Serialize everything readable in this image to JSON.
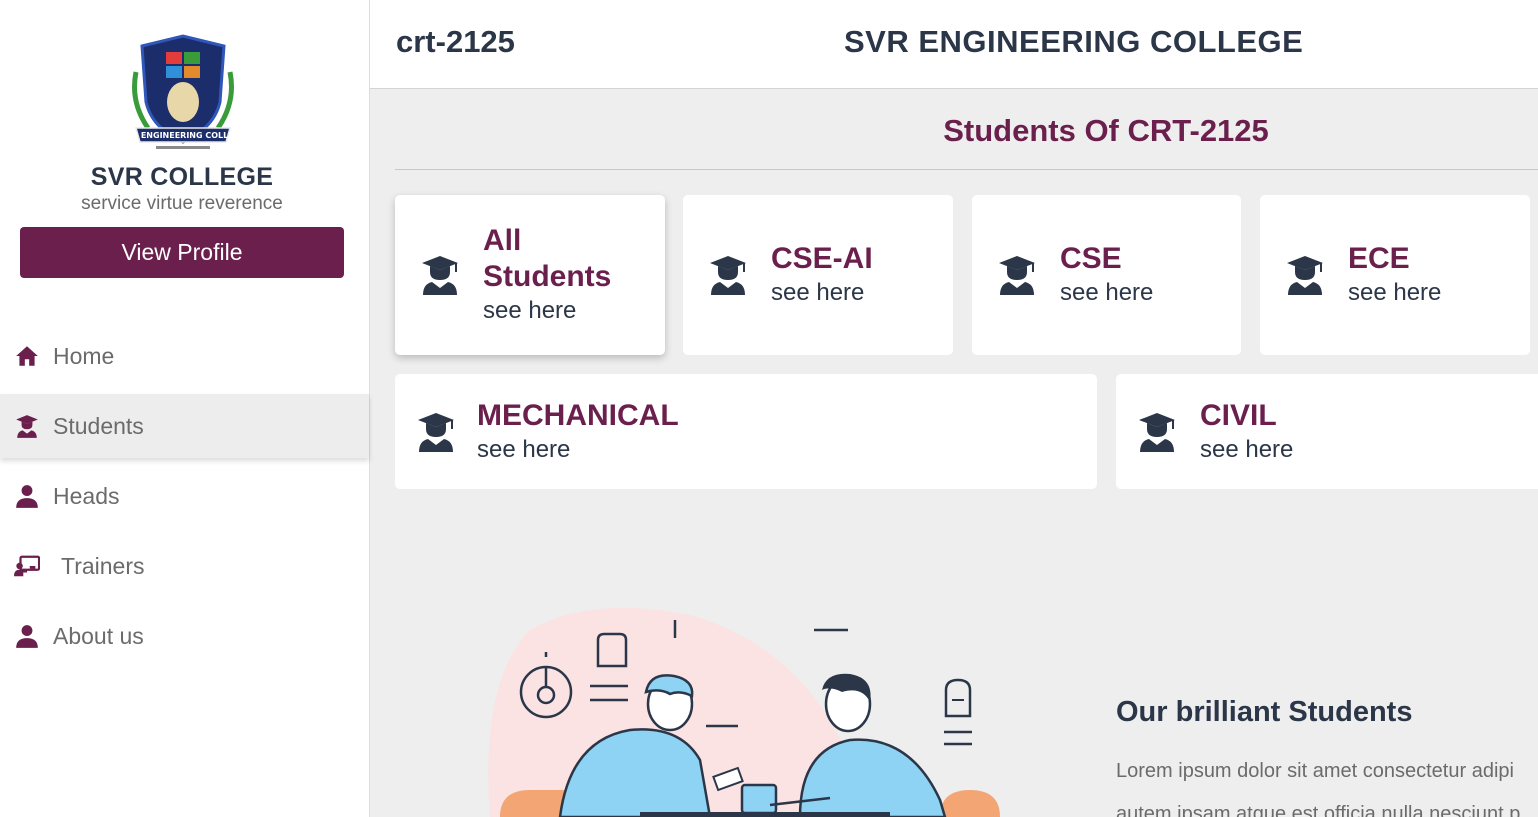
{
  "sidebar": {
    "college_name": "SVR COLLEGE",
    "college_tagline": "service virtue reverence",
    "logo_text": "VB ENGINEERING COLLEG",
    "view_profile_label": "View Profile",
    "nav": [
      {
        "label": "Home",
        "icon": "home-icon"
      },
      {
        "label": "Students",
        "icon": "student-icon",
        "active": true
      },
      {
        "label": "Heads",
        "icon": "person-icon"
      },
      {
        "label": "Trainers",
        "icon": "trainer-icon"
      },
      {
        "label": "About us",
        "icon": "person-icon"
      }
    ]
  },
  "header": {
    "batch": "crt-2125",
    "title": "SVR ENGINEERING COLLEGE"
  },
  "main": {
    "section_title": "Students Of CRT-2125",
    "cards": [
      {
        "title": "All Students",
        "subtitle": "see here",
        "icon": "graduate-icon"
      },
      {
        "title": "CSE-AI",
        "subtitle": "see here",
        "icon": "graduate-icon"
      },
      {
        "title": "CSE",
        "subtitle": "see here",
        "icon": "graduate-icon"
      },
      {
        "title": "ECE",
        "subtitle": "see here",
        "icon": "graduate-icon"
      },
      {
        "title": "MECHANICAL",
        "subtitle": "see here",
        "icon": "graduate-icon"
      },
      {
        "title": "CIVIL",
        "subtitle": "see here",
        "icon": "graduate-icon"
      }
    ],
    "brilliant_title": "Our brilliant Students",
    "lorem_lines": [
      "Lorem ipsum dolor sit amet consectetur adipi",
      "autem ipsam atque est officia nulla nesciunt p"
    ]
  },
  "colors": {
    "brand": "#6b1f4c",
    "text_dark": "#2b3648",
    "text_muted": "#6b6b6b",
    "background": "#eeeeee"
  }
}
